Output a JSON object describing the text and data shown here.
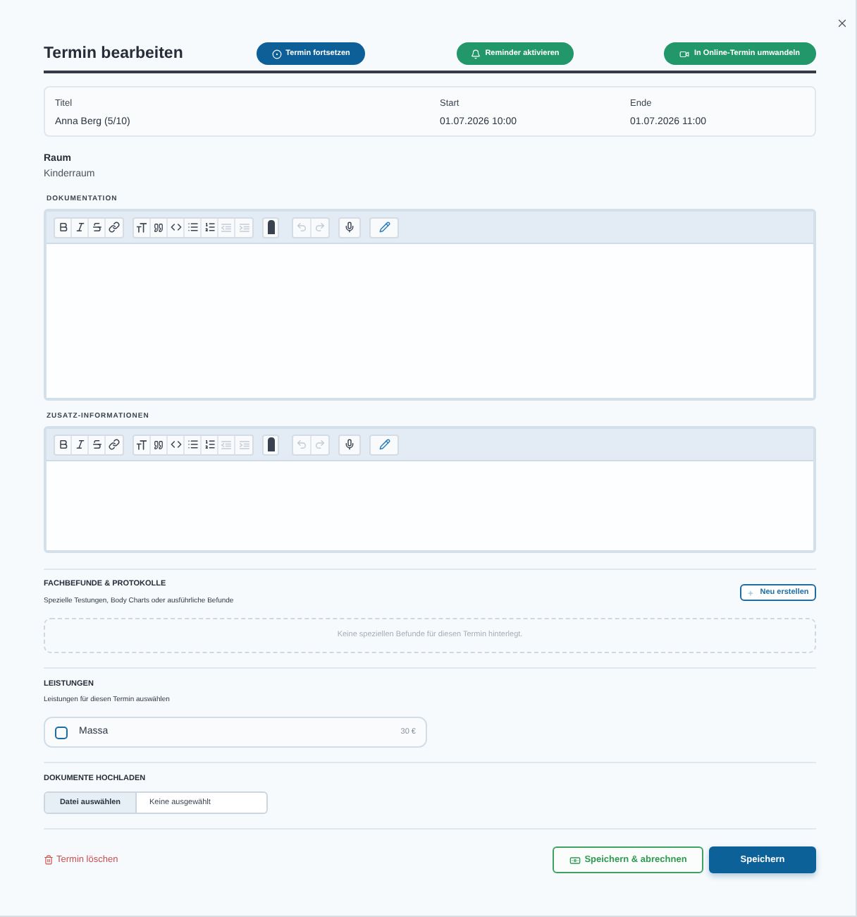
{
  "dialog": {
    "title": "Termin bearbeiten"
  },
  "header_actions": [
    {
      "label": "Termin fortsetzen",
      "kind": "primary"
    },
    {
      "label": "Reminder aktivieren",
      "kind": "success"
    },
    {
      "label": "In Online-Termin umwandeln",
      "kind": "success"
    }
  ],
  "details": [
    {
      "label": "Titel",
      "value": "Anna Berg (5/10)"
    },
    {
      "label": "Start",
      "value": "01.07.2026 10:00"
    },
    {
      "label": "Ende",
      "value": "01.07.2026 11:00"
    }
  ],
  "room": {
    "label": "Raum",
    "value": "Kinderraum"
  },
  "editors": [
    {
      "label": "DOKUMENTATION",
      "toolbar": [
        {
          "disabled": false
        },
        {
          "disabled": false
        },
        {
          "disabled": false
        },
        {
          "disabled": false
        },
        {
          "disabled": false
        },
        {
          "disabled": false
        },
        {
          "disabled": false
        },
        {
          "disabled": false
        },
        {
          "disabled": false
        },
        {
          "disabled": true
        },
        {
          "disabled": true
        },
        {
          "disabled": false
        },
        {
          "disabled": true
        },
        {
          "disabled": true
        },
        {
          "disabled": false
        },
        {
          "disabled": false
        }
      ]
    },
    {
      "label": "ZUSATZ-INFORMATIONEN",
      "toolbar": [
        {
          "disabled": false
        },
        {
          "disabled": false
        },
        {
          "disabled": false
        },
        {
          "disabled": false
        },
        {
          "disabled": false
        },
        {
          "disabled": false
        },
        {
          "disabled": false
        },
        {
          "disabled": false
        },
        {
          "disabled": false
        },
        {
          "disabled": true
        },
        {
          "disabled": true
        },
        {
          "disabled": false
        },
        {
          "disabled": true
        },
        {
          "disabled": true
        },
        {
          "disabled": false
        },
        {
          "disabled": false
        }
      ]
    }
  ],
  "findings": {
    "title": "FACHBEFUNDE & PROTOKOLLE",
    "subtitle": "Spezielle Testungen, Body Charts oder ausführliche Befunde",
    "action": "Neu erstellen",
    "empty": "Keine speziellen Befunde für diesen Termin hinterlegt."
  },
  "services": {
    "title": "LEISTUNGEN",
    "subtitle": "Leistungen für diesen Termin auswählen",
    "items": [
      {
        "name": "Massa",
        "price": "30 €",
        "checked": false
      }
    ]
  },
  "uploads": {
    "title": "DOKUMENTE HOCHLADEN",
    "button": "Datei auswählen",
    "status": "Keine ausgewählt"
  },
  "footer": {
    "delete": "Termin löschen",
    "actions": [
      {
        "label": "Speichern & abrechnen",
        "kind": "outline"
      },
      {
        "label": "Speichern",
        "kind": "primary"
      }
    ]
  }
}
